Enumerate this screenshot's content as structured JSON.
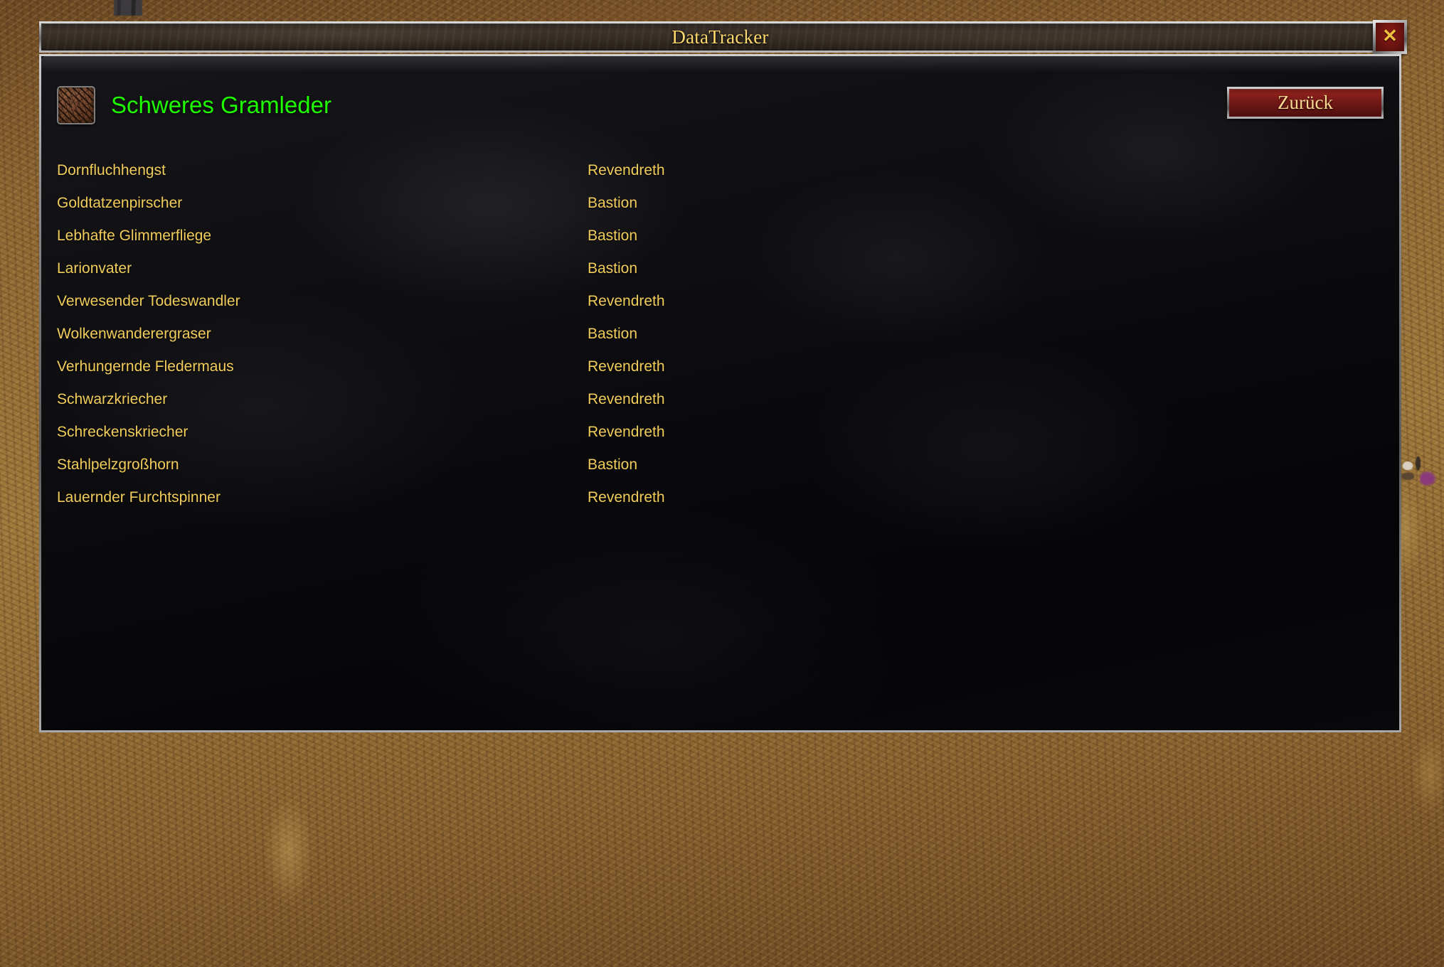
{
  "window": {
    "title": "DataTracker",
    "close_icon": "close-x-icon"
  },
  "header": {
    "item_icon": "leather-item-icon",
    "item_name": "Schweres Gramleder",
    "item_name_color": "#1eff00",
    "back_button_label": "Zurück"
  },
  "colors": {
    "text_gold": "#f2cd5c",
    "title_gold": "#ffd96b",
    "item_quality_green": "#1eff00",
    "button_red": "#8a201c",
    "close_red": "#8e1b14",
    "panel_black": "#0a0a0c",
    "frame_metal": "#9a9a9a"
  },
  "list": {
    "rows": [
      {
        "name": "Dornfluchhengst",
        "zone": "Revendreth"
      },
      {
        "name": "Goldtatzenpirscher",
        "zone": "Bastion"
      },
      {
        "name": "Lebhafte Glimmerfliege",
        "zone": "Bastion"
      },
      {
        "name": "Larionvater",
        "zone": "Bastion"
      },
      {
        "name": "Verwesender Todeswandler",
        "zone": "Revendreth"
      },
      {
        "name": "Wolkenwanderergraser",
        "zone": "Bastion"
      },
      {
        "name": "Verhungernde Fledermaus",
        "zone": "Revendreth"
      },
      {
        "name": "Schwarzkriecher",
        "zone": "Revendreth"
      },
      {
        "name": "Schreckenskriecher",
        "zone": "Revendreth"
      },
      {
        "name": "Stahlpelzgroßhorn",
        "zone": "Bastion"
      },
      {
        "name": "Lauernder Furchtspinner",
        "zone": "Revendreth"
      }
    ]
  }
}
